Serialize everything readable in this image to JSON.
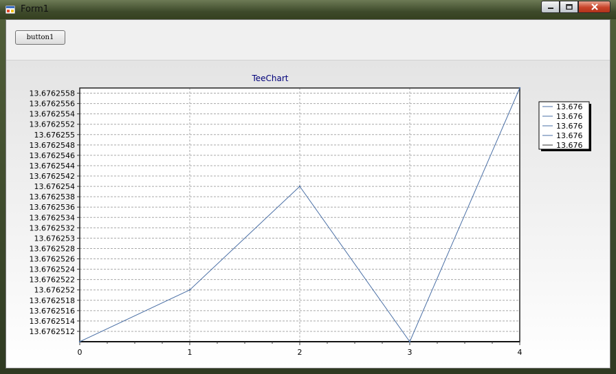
{
  "window": {
    "title": "Form1"
  },
  "toolbar": {
    "button1_label": "button1"
  },
  "chart_data": {
    "type": "line",
    "title": "TeeChart",
    "x": [
      0,
      1,
      2,
      3,
      4
    ],
    "values": [
      13.676251,
      13.676252,
      13.676254,
      13.676251,
      13.6762559
    ],
    "ylim": [
      13.676251,
      13.6762559
    ],
    "xlim": [
      0,
      4
    ],
    "x_ticks": [
      "0",
      "1",
      "2",
      "3",
      "4"
    ],
    "y_ticks": [
      "13.6762558",
      "13.6762556",
      "13.6762554",
      "13.6762552",
      "13.676255",
      "13.6762548",
      "13.6762546",
      "13.6762544",
      "13.6762542",
      "13.676254",
      "13.6762538",
      "13.6762536",
      "13.6762534",
      "13.6762532",
      "13.676253",
      "13.6762528",
      "13.6762526",
      "13.6762524",
      "13.6762522",
      "13.676252",
      "13.6762518",
      "13.6762516",
      "13.6762514",
      "13.6762512"
    ],
    "legend": [
      "13.676",
      "13.676",
      "13.676",
      "13.676",
      "13.676"
    ],
    "legend_position": "right",
    "grid": true,
    "line_color": "#4a6fa5"
  }
}
